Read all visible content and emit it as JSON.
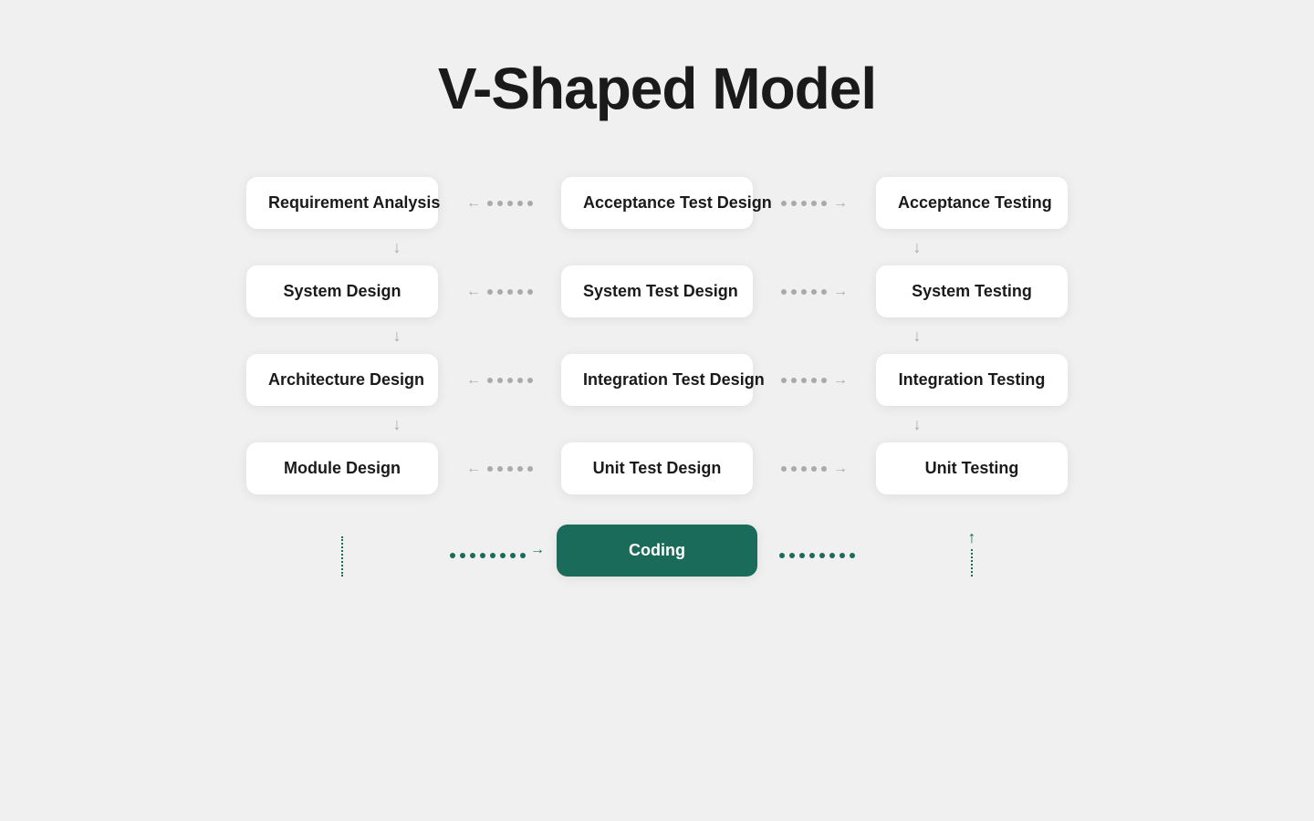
{
  "title": "V-Shaped Model",
  "rows": [
    {
      "left": "Requirement Analysis",
      "center": "Acceptance Test Design",
      "right": "Acceptance Testing"
    },
    {
      "left": "System Design",
      "center": "System Test Design",
      "right": "System Testing"
    },
    {
      "left": "Architecture Design",
      "center": "Integration Test Design",
      "right": "Integration Testing"
    },
    {
      "left": "Module Design",
      "center": "Unit Test Design",
      "right": "Unit Testing"
    }
  ],
  "coding": "Coding",
  "dots": {
    "count": 5
  }
}
